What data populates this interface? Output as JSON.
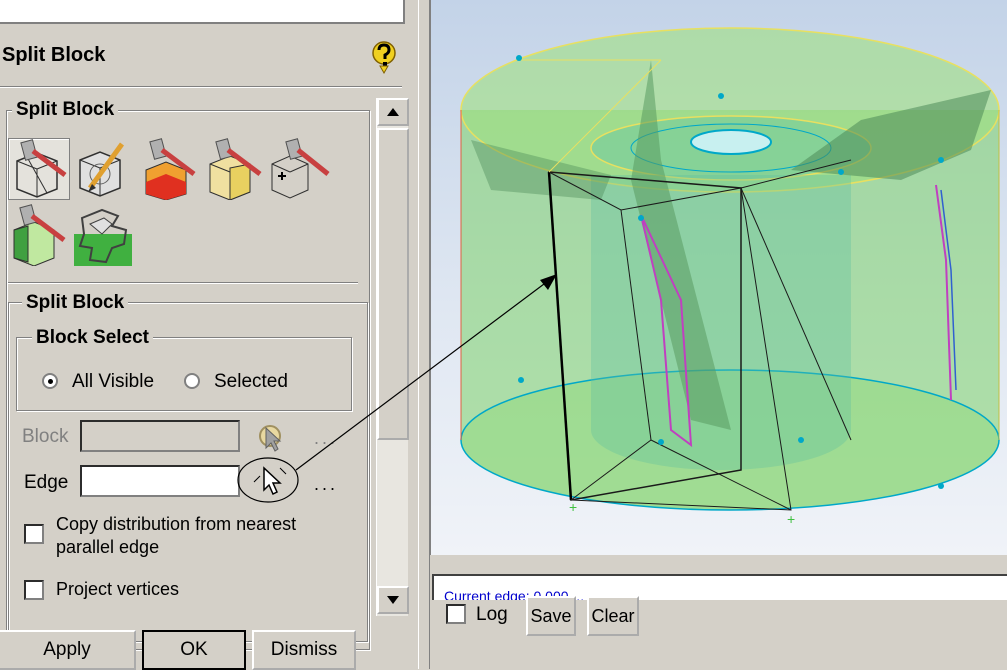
{
  "panel": {
    "title": "Split Block",
    "help_icon": "help-question-icon"
  },
  "tools_group": {
    "legend": "Split Block",
    "icons": [
      "split-block-icon",
      "split-face-icon",
      "split-free-icon",
      "split-prescribed-icon",
      "split-vertex-icon",
      "split-index-icon",
      "split-topology-icon"
    ]
  },
  "split_group": {
    "legend": "Split Block"
  },
  "block_select": {
    "legend": "Block Select",
    "option_all": "All Visible",
    "option_selected": "Selected",
    "selected_value": "All Visible"
  },
  "block_field": {
    "label": "Block",
    "value": "",
    "dots": "..."
  },
  "edge_field": {
    "label": "Edge",
    "value": "",
    "dots": "..."
  },
  "options": {
    "copy_distribution_line1": "Copy distribution from nearest",
    "copy_distribution_line2": "parallel edge",
    "project_vertices": "Project vertices"
  },
  "buttons": {
    "apply": "Apply",
    "ok": "OK",
    "dismiss": "Dismiss"
  },
  "message": {
    "text": "Current edge: 0.000 ...",
    "log_label": "Log",
    "save": "Save",
    "clear": "Clear"
  },
  "colors": {
    "cylinder_green": "#7ed26a",
    "edge_blue": "#00a8c8",
    "edge_yellow": "#e8e060",
    "edge_magenta": "#c040c0"
  }
}
